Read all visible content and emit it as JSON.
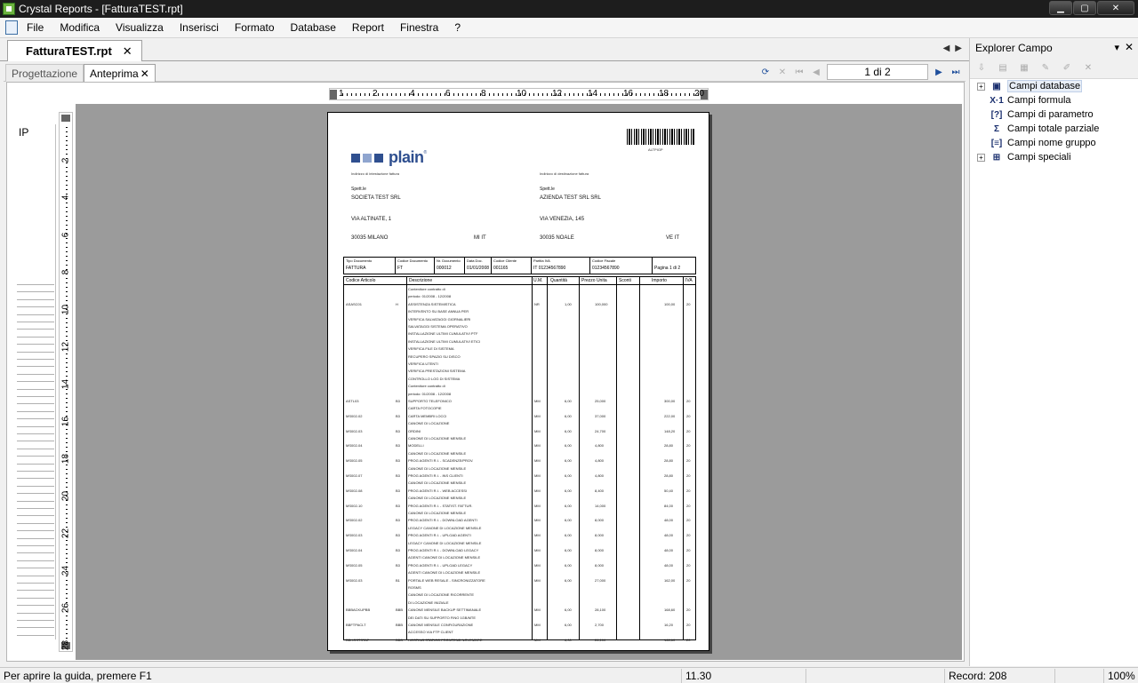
{
  "window": {
    "title": "Crystal Reports - [FatturaTEST.rpt]",
    "controls": [
      "minimize-icon",
      "maximize-icon",
      "close-icon"
    ]
  },
  "menu": [
    "File",
    "Modifica",
    "Visualizza",
    "Inserisci",
    "Formato",
    "Database",
    "Report",
    "Finestra",
    "?"
  ],
  "doc_tab": {
    "label": "FatturaTEST.rpt",
    "close": "✕"
  },
  "view_tabs": {
    "design": "Progettazione",
    "preview": "Anteprima",
    "close": "✕"
  },
  "navigation": {
    "page_field": "1 di 2"
  },
  "section": {
    "label": "IP"
  },
  "ruler": {
    "h_ticks": [
      "1",
      "2",
      "4",
      "6",
      "8",
      "10",
      "12",
      "14",
      "16",
      "18",
      "20"
    ],
    "v_ticks": [
      "2",
      "4",
      "6",
      "8",
      "10",
      "12",
      "14",
      "16",
      "18",
      "20",
      "22",
      "24",
      "26",
      "28"
    ]
  },
  "report": {
    "barcode_text": "ALTPIGP",
    "logo": "plain",
    "logo_reg": "®",
    "colors": {
      "logo_sq1": "#2f4f8f",
      "logo_sq2": "#8fa5cf",
      "logo_sq3": "#2f4f8f"
    },
    "billing_label": "Indirizzo di intestazione fattura",
    "shipping_label": "Indirizzo di destinazione fattura",
    "spett_left": "Spett.le",
    "spett_right": "Spett.le",
    "left_company": "SOCIETA TEST SRL",
    "right_company": "AZIENDA TEST SRL SRL",
    "left_address": "VIA ALTINATE, 1",
    "right_address": "VIA VENEZIA, 145",
    "left_city": "30035   MILANO",
    "left_prov": "MI    IT",
    "right_city": "30035   NOALE",
    "right_prov": "VE    IT",
    "doc_header": {
      "labels": [
        "Tipo Documento",
        "Codice Documento",
        "Nr. Documento",
        "Data Doc.",
        "Codice Cliente",
        "Partita IVA",
        "Codice Fiscale",
        ""
      ],
      "values": [
        "FATTURA",
        "FT",
        "000012",
        "01/01/2008",
        "001165",
        "IT 01234567890",
        "01234567890",
        "Pagina 1 di 2"
      ]
    },
    "columns": [
      "Codice Articolo",
      "Descrizione",
      "U.M.",
      "Quantità",
      "Prezzo Unita",
      "Sconti",
      "Importo",
      "IVA"
    ],
    "rows": [
      {
        "code": "",
        "cat": "",
        "desc": "Contenitore contratto di",
        "um": "",
        "qty": "",
        "price": "",
        "amount": "",
        "iva": ""
      },
      {
        "code": "",
        "cat": "",
        "desc": "periodo: 01/2008 - 12/2008",
        "um": "",
        "qty": "",
        "price": "",
        "amount": "",
        "iva": ""
      },
      {
        "code": "ASASC01",
        "cat": "H",
        "desc": "ASSISTENZA SISTEMISTICA",
        "um": "NR",
        "qty": "1,00",
        "price": "100,000",
        "amount": "100,00",
        "iva": "20"
      },
      {
        "code": "",
        "cat": "",
        "desc": "INTERVENTO SU BASE ANNUA PER",
        "um": "",
        "qty": "",
        "price": "",
        "amount": "",
        "iva": ""
      },
      {
        "code": "",
        "cat": "",
        "desc": "VERIFICA SALVATAGGI GIORNALIERI",
        "um": "",
        "qty": "",
        "price": "",
        "amount": "",
        "iva": ""
      },
      {
        "code": "",
        "cat": "",
        "desc": "SALVATAGGI SISTEMA OPERATIVO",
        "um": "",
        "qty": "",
        "price": "",
        "amount": "",
        "iva": ""
      },
      {
        "code": "",
        "cat": "",
        "desc": "INSTALLAZIONE ULTIMI CUMULATIVI PTF",
        "um": "",
        "qty": "",
        "price": "",
        "amount": "",
        "iva": ""
      },
      {
        "code": "",
        "cat": "",
        "desc": "INSTALLAZIONE ULTIMI CUMULATIVI ETICI",
        "um": "",
        "qty": "",
        "price": "",
        "amount": "",
        "iva": ""
      },
      {
        "code": "",
        "cat": "",
        "desc": "VERIFICA FILE DI SISTEMA",
        "um": "",
        "qty": "",
        "price": "",
        "amount": "",
        "iva": ""
      },
      {
        "code": "",
        "cat": "",
        "desc": "RECUPERO SPAZIO SU DISCO",
        "um": "",
        "qty": "",
        "price": "",
        "amount": "",
        "iva": ""
      },
      {
        "code": "",
        "cat": "",
        "desc": "VERIFICA UTENTI",
        "um": "",
        "qty": "",
        "price": "",
        "amount": "",
        "iva": ""
      },
      {
        "code": "",
        "cat": "",
        "desc": "VERIFICA PRESTAZIONI SISTEMA",
        "um": "",
        "qty": "",
        "price": "",
        "amount": "",
        "iva": ""
      },
      {
        "code": "",
        "cat": "",
        "desc": "CONTROLLO LOG DI SISTEMA",
        "um": "",
        "qty": "",
        "price": "",
        "amount": "",
        "iva": ""
      },
      {
        "code": "",
        "cat": "",
        "desc": "Contenitore contratto di",
        "um": "",
        "qty": "",
        "price": "",
        "amount": "",
        "iva": ""
      },
      {
        "code": "",
        "cat": "",
        "desc": "periodo: 01/2008 - 12/2008",
        "um": "",
        "qty": "",
        "price": "",
        "amount": "",
        "iva": ""
      },
      {
        "code": "ASTL03",
        "cat": "B3",
        "desc": "SUPPORTO TELEFONICO",
        "um": "MM",
        "qty": "6,00",
        "price": "25,000",
        "amount": "300,00",
        "iva": "20"
      },
      {
        "code": "",
        "cat": "",
        "desc": "CARTA FOTOCOPIE",
        "um": "",
        "qty": "",
        "price": "",
        "amount": "",
        "iva": ""
      },
      {
        "code": "MS002-02",
        "cat": "B3",
        "desc": "CARTA MEMBRI LOCCI",
        "um": "MM",
        "qty": "6,00",
        "price": "37,000",
        "amount": "222,00",
        "iva": "20"
      },
      {
        "code": "",
        "cat": "",
        "desc": "CANONE DI LOCAZIONE",
        "um": "",
        "qty": "",
        "price": "",
        "amount": "",
        "iva": ""
      },
      {
        "code": "MS002-03",
        "cat": "B3",
        "desc": "ORDINI",
        "um": "MM",
        "qty": "6,00",
        "price": "24,700",
        "amount": "148,20",
        "iva": "20"
      },
      {
        "code": "",
        "cat": "",
        "desc": "CANONE DI LOCAZIONE MENSILE",
        "um": "",
        "qty": "",
        "price": "",
        "amount": "",
        "iva": ""
      },
      {
        "code": "MS002-04",
        "cat": "B3",
        "desc": "MODELLI",
        "um": "MM",
        "qty": "6,00",
        "price": "4,800",
        "amount": "28,80",
        "iva": "20"
      },
      {
        "code": "",
        "cat": "",
        "desc": "CANONE DI LOCAZIONE MENSILE",
        "um": "",
        "qty": "",
        "price": "",
        "amount": "",
        "iva": ""
      },
      {
        "code": "MS002-05",
        "cat": "B3",
        "desc": "PROG AGENTI R.I. - SCADENZE/PROV.",
        "um": "MM",
        "qty": "6,00",
        "price": "4,800",
        "amount": "28,80",
        "iva": "20"
      },
      {
        "code": "",
        "cat": "",
        "desc": "CANONE DI LOCAZIONE MENSILE",
        "um": "",
        "qty": "",
        "price": "",
        "amount": "",
        "iva": ""
      },
      {
        "code": "MS002-07",
        "cat": "B3",
        "desc": "PROG AGENTI R.I. - INS CLIENTI",
        "um": "MM",
        "qty": "6,00",
        "price": "4,800",
        "amount": "28,80",
        "iva": "20"
      },
      {
        "code": "",
        "cat": "",
        "desc": "CANONE DI LOCAZIONE MENSILE",
        "um": "",
        "qty": "",
        "price": "",
        "amount": "",
        "iva": ""
      },
      {
        "code": "MS002-08",
        "cat": "B3",
        "desc": "PROG AGENTI R.I. - WEB ACCESSI",
        "um": "MM",
        "qty": "6,00",
        "price": "8,400",
        "amount": "50,40",
        "iva": "20"
      },
      {
        "code": "",
        "cat": "",
        "desc": "CANONE DI LOCAZIONE MENSILE",
        "um": "",
        "qty": "",
        "price": "",
        "amount": "",
        "iva": ""
      },
      {
        "code": "MS002-10",
        "cat": "B3",
        "desc": "PROG AGENTI R.I. - STATIST. FATTUR.",
        "um": "MM",
        "qty": "6,00",
        "price": "14,000",
        "amount": "84,00",
        "iva": "20"
      },
      {
        "code": "",
        "cat": "",
        "desc": "CANONE DI LOCAZIONE MENSILE",
        "um": "",
        "qty": "",
        "price": "",
        "amount": "",
        "iva": ""
      },
      {
        "code": "MS002-02",
        "cat": "B3",
        "desc": "PROG AGENTI R.I. - DOWNLOAD AGENTI",
        "um": "MM",
        "qty": "6,00",
        "price": "8,000",
        "amount": "48,00",
        "iva": "20"
      },
      {
        "code": "",
        "cat": "",
        "desc": "LEGACY CANONE DI LOCAZIONE MENSILE",
        "um": "",
        "qty": "",
        "price": "",
        "amount": "",
        "iva": ""
      },
      {
        "code": "MS002-03",
        "cat": "B3",
        "desc": "PROG AGENTI R.I. - UPLOAD AGENTI",
        "um": "MM",
        "qty": "6,00",
        "price": "8,000",
        "amount": "48,00",
        "iva": "20"
      },
      {
        "code": "",
        "cat": "",
        "desc": "LEGACY CANONE DI LOCAZIONE MENSILE",
        "um": "",
        "qty": "",
        "price": "",
        "amount": "",
        "iva": ""
      },
      {
        "code": "MS002-04",
        "cat": "B3",
        "desc": "PROG AGENTI R.I. - DOWNLOAD LEGACY",
        "um": "MM",
        "qty": "6,00",
        "price": "8,000",
        "amount": "48,00",
        "iva": "20"
      },
      {
        "code": "",
        "cat": "",
        "desc": "AGENTI CANONE DI LOCAZIONE MENSILE",
        "um": "",
        "qty": "",
        "price": "",
        "amount": "",
        "iva": ""
      },
      {
        "code": "MS002-05",
        "cat": "B3",
        "desc": "PROG AGENTI R.I. - UPLOAD LEGACY",
        "um": "MM",
        "qty": "6,00",
        "price": "8,000",
        "amount": "48,00",
        "iva": "20"
      },
      {
        "code": "",
        "cat": "",
        "desc": "AGENTI CANONE DI LOCAZIONE MENSILE",
        "um": "",
        "qty": "",
        "price": "",
        "amount": "",
        "iva": ""
      },
      {
        "code": "MS002-03",
        "cat": "B1",
        "desc": "PORTALE WEB RESALE - SINCRONIZZATORE",
        "um": "MM",
        "qty": "6,00",
        "price": "27,000",
        "amount": "162,00",
        "iva": "20"
      },
      {
        "code": "",
        "cat": "",
        "desc": "ROSMS",
        "um": "",
        "qty": "",
        "price": "",
        "amount": "",
        "iva": ""
      },
      {
        "code": "",
        "cat": "",
        "desc": "CANONE DI LOCAZIONE RICORRENTE",
        "um": "",
        "qty": "",
        "price": "",
        "amount": "",
        "iva": ""
      },
      {
        "code": "",
        "cat": "",
        "desc": "DI LOCAZIONE INIZIALE",
        "um": "",
        "qty": "",
        "price": "",
        "amount": "",
        "iva": ""
      },
      {
        "code": "BBBACKUPBB",
        "cat": "BBB",
        "desc": "CANONE MENSILE BACKUP SETTIMANALE",
        "um": "MM",
        "qty": "6,00",
        "price": "28,100",
        "amount": "168,60",
        "iva": "20"
      },
      {
        "code": "",
        "cat": "",
        "desc": "DEI DATI SU SUPPORTO FINO 1GB/MTE",
        "um": "",
        "qty": "",
        "price": "",
        "amount": "",
        "iva": ""
      },
      {
        "code": "BBFTPACLT",
        "cat": "BBB",
        "desc": "CANONE MENSILE CONFIGURAZIONE",
        "um": "MM",
        "qty": "6,00",
        "price": "2,700",
        "amount": "16,20",
        "iva": "20"
      },
      {
        "code": "",
        "cat": "",
        "desc": "ACCESSO VIA FTP CLIENT",
        "um": "",
        "qty": "",
        "price": "",
        "amount": "",
        "iva": ""
      },
      {
        "code": "BBHOSTSTAT",
        "cat": "BBB",
        "desc": "HOSTING STATICO FRONTEND NOVEMBRE",
        "um": "MM",
        "qty": "6,00",
        "price": "28,100",
        "amount": "168,60",
        "iva": "20"
      }
    ]
  },
  "explorer": {
    "title": "Explorer Campo",
    "pin": "📌",
    "close": "✕",
    "items": [
      {
        "label": "Campi database",
        "icon": "database-icon",
        "glyph": "▣",
        "expandable": true,
        "selected": true
      },
      {
        "label": "Campi formula",
        "icon": "formula-icon",
        "glyph": "X·1",
        "expandable": false,
        "selected": false
      },
      {
        "label": "Campi di parametro",
        "icon": "parameter-icon",
        "glyph": "[?]",
        "expandable": false,
        "selected": false
      },
      {
        "label": "Campi totale parziale",
        "icon": "sum-icon",
        "glyph": "Σ",
        "expandable": false,
        "selected": false
      },
      {
        "label": "Campi nome gruppo",
        "icon": "group-icon",
        "glyph": "[≡]",
        "expandable": false,
        "selected": false
      },
      {
        "label": "Campi speciali",
        "icon": "special-icon",
        "glyph": "⊞",
        "expandable": true,
        "selected": false
      }
    ]
  },
  "status": {
    "help": "Per aprire la guida, premere F1",
    "position": "11.30",
    "blank": "",
    "records": "Record:  208",
    "zoom": "100%"
  }
}
